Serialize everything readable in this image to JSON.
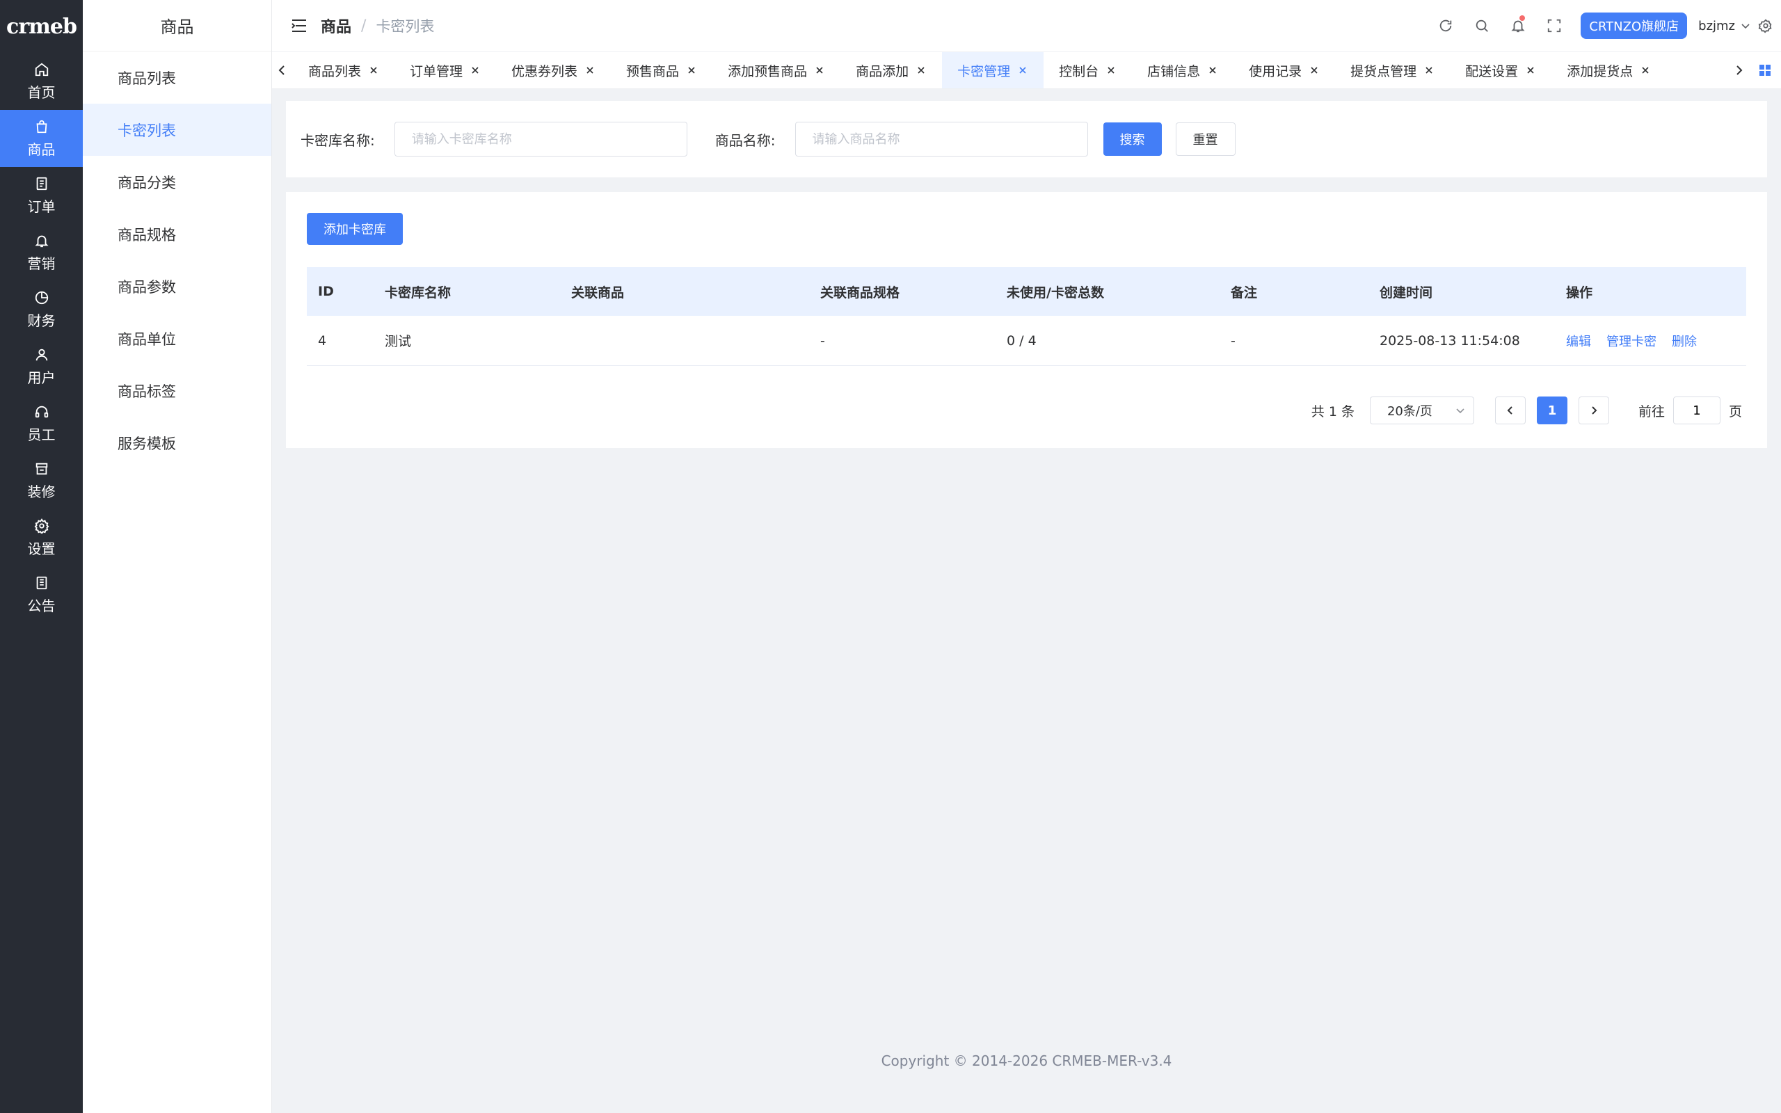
{
  "logo": "crmeb",
  "rail": [
    {
      "label": "首页",
      "icon": "home-icon"
    },
    {
      "label": "商品",
      "icon": "bag-icon",
      "active": true
    },
    {
      "label": "订单",
      "icon": "document-icon"
    },
    {
      "label": "营销",
      "icon": "bell-icon"
    },
    {
      "label": "财务",
      "icon": "pie-chart-icon"
    },
    {
      "label": "用户",
      "icon": "user-icon"
    },
    {
      "label": "员工",
      "icon": "headset-icon"
    },
    {
      "label": "装修",
      "icon": "store-icon"
    },
    {
      "label": "设置",
      "icon": "gear-icon"
    },
    {
      "label": "公告",
      "icon": "notice-icon"
    }
  ],
  "submenu": {
    "title": "商品",
    "items": [
      "商品列表",
      "卡密列表",
      "商品分类",
      "商品规格",
      "商品参数",
      "商品单位",
      "商品标签",
      "服务模板"
    ]
  },
  "header": {
    "crumb1": "商品",
    "crumb_sep": "/",
    "crumb2": "卡密列表",
    "store": "CRTNZO旗舰店",
    "user": "bzjmz"
  },
  "tabs": [
    "商品列表",
    "订单管理",
    "优惠券列表",
    "预售商品",
    "添加预售商品",
    "商品添加",
    "卡密管理",
    "控制台",
    "店铺信息",
    "使用记录",
    "提货点管理",
    "配送设置",
    "添加提货点"
  ],
  "search": {
    "lib_label": "卡密库名称:",
    "lib_placeholder": "请输入卡密库名称",
    "product_label": "商品名称:",
    "product_placeholder": "请输入商品名称",
    "search_btn": "搜索",
    "reset_btn": "重置"
  },
  "table": {
    "add_btn": "添加卡密库",
    "headers": [
      "ID",
      "卡密库名称",
      "关联商品",
      "关联商品规格",
      "未使用/卡密总数",
      "备注",
      "创建时间",
      "操作"
    ],
    "rows": [
      {
        "id": "4",
        "name": "测试",
        "product": "",
        "spec": "-",
        "count": "0 / 4",
        "remark": "-",
        "created": "2025-08-13 11:54:08"
      }
    ],
    "actions": [
      "编辑",
      "管理卡密",
      "删除"
    ]
  },
  "pagination": {
    "total": "共 1 条",
    "page_size": "20条/页",
    "current": "1",
    "goto_label": "前往",
    "goto_value": "1",
    "page_suffix": "页"
  },
  "footer": "Copyright © 2014-2026 CRMEB-MER-v3.4",
  "colors": {
    "primary": "#437ef7",
    "rail_bg": "#282c34",
    "page_bg": "#f0f2f5"
  }
}
